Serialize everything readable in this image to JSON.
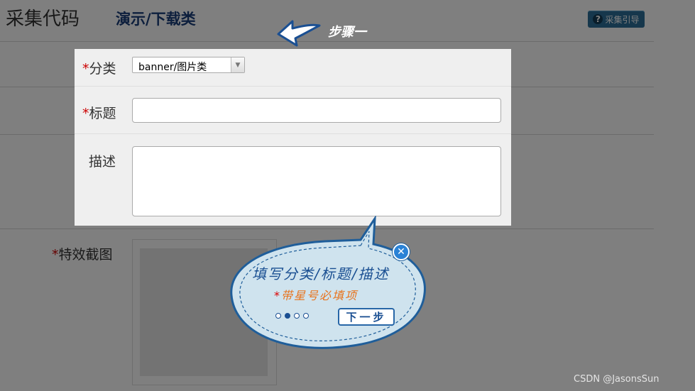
{
  "header": {
    "title": "采集代码",
    "subtitle": "演示/下载类",
    "guide_button": {
      "label": "采集引导",
      "icon": "help-icon",
      "icon_glyph": "?"
    }
  },
  "form": {
    "required_mark": "*",
    "category": {
      "label": "分类",
      "value": "banner/图片类",
      "required": true
    },
    "title_field": {
      "label": "标题",
      "value": "",
      "required": true
    },
    "description": {
      "label": "描述",
      "value": "",
      "required": false
    },
    "effect_screenshot": {
      "label": "特效截图",
      "required": true
    }
  },
  "tour": {
    "step_label": "步骤一",
    "line1": "填写分类/标题/描述",
    "line2_star": "*",
    "line2": "带星号必填项",
    "pages": 4,
    "current_page": 2,
    "next_label": "下一步",
    "close_icon": "close-icon"
  },
  "watermark": "CSDN @JasonsSun",
  "colors": {
    "overlay": "rgba(0,0,0,0.5)",
    "subtitle": "#1a3e7a",
    "required": "#cc0000",
    "bubble_text": "#1a4f92",
    "bubble_hint": "#e8731d",
    "guide_button": "#2c6f98"
  }
}
